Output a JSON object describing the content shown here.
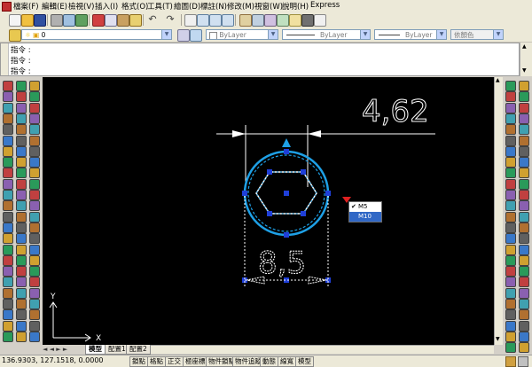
{
  "menu": {
    "items": [
      "檔案(F)",
      "編輯(E)",
      "檢視(V)",
      "插入(I)",
      "格式(O)",
      "工具(T)",
      "繪圖(D)",
      "標註(N)",
      "修改(M)",
      "視窗(W)",
      "說明(H)",
      "Express"
    ]
  },
  "properties_bar": {
    "layer_value": "0",
    "color_value": "ByLayer",
    "linetype_value": "ByLayer",
    "lineweight_value": "ByLayer",
    "plotstyle_value": "依顏色"
  },
  "command_line": {
    "lines": [
      "指令 :",
      "指令 :",
      "指令 :"
    ]
  },
  "drawing": {
    "dim_horizontal": "4,62",
    "dim_diameter": "8,5",
    "ucs_x": "X",
    "ucs_y": "Y"
  },
  "popup_menu": {
    "options": [
      "M5",
      "M10"
    ],
    "checked_index": 0,
    "highlighted_index": 1
  },
  "tabs": {
    "model": "模型",
    "layout1": "配置1",
    "layout2": "配置2"
  },
  "status": {
    "coordinates": "136.9303, 127.1518, 0.0000",
    "buttons": [
      "鎖點",
      "格點",
      "正交",
      "極座標",
      "物件鎖點",
      "物件追蹤",
      "動態",
      "線寬",
      "模型"
    ]
  },
  "colors": {
    "canvas": "#000000",
    "circle": "#1ea0e6",
    "grip": "#1f3fd8",
    "marker": "#e02020",
    "dimension": "#ffffff",
    "highlight": "#3168c6"
  },
  "icons": {
    "app": "autocad-app-icon",
    "new": "new-file-icon",
    "open": "open-file-icon",
    "save": "save-icon",
    "print": "print-icon",
    "undo": "undo-icon",
    "redo": "redo-icon",
    "pan": "pan-icon",
    "zoom": "zoom-icon",
    "calculator": "calculator-icon",
    "layer": "layer-icon",
    "checkmark": "checkmark-icon"
  }
}
